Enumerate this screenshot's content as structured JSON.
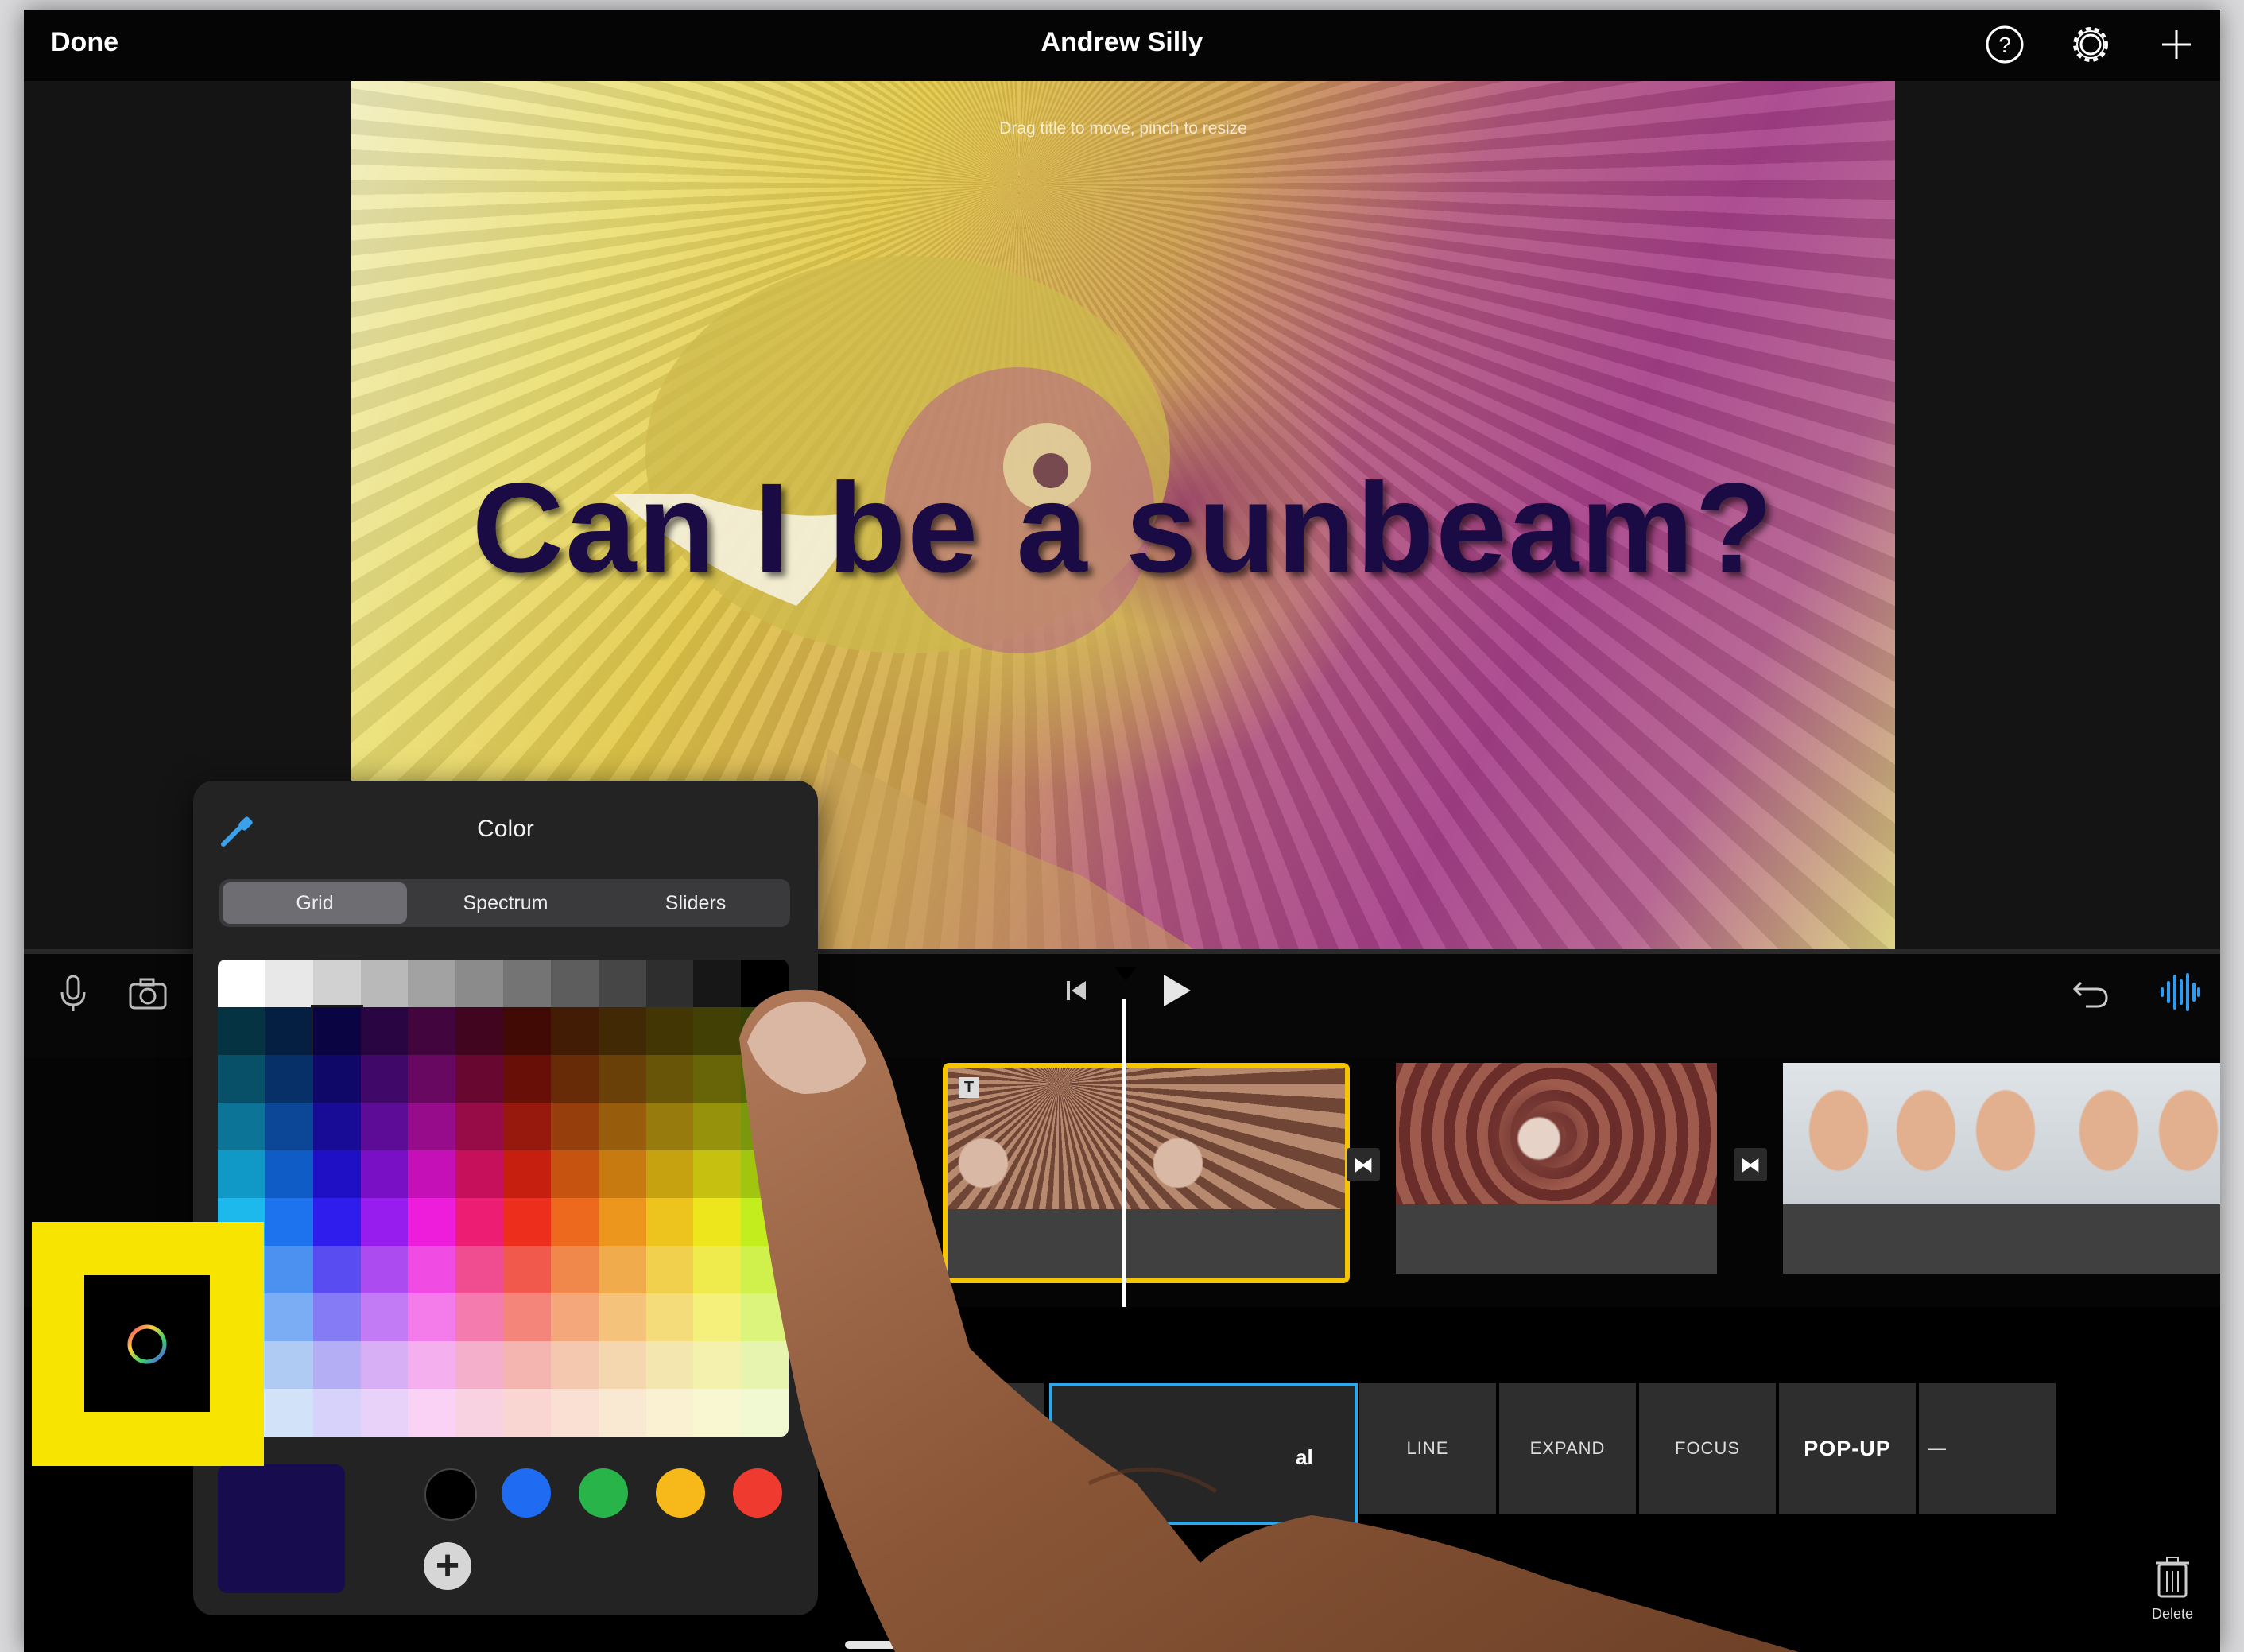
{
  "topbar": {
    "done_label": "Done",
    "project_title": "Andrew Silly",
    "icons": [
      "help-icon",
      "settings-gear-icon",
      "add-plus-icon"
    ]
  },
  "viewer": {
    "hint": "Drag title to move, pinch to resize",
    "caption": "Can I be a sunbeam?",
    "caption_color": "#1a0b44"
  },
  "timeline": {
    "left_icons": [
      "microphone-icon",
      "camera-icon"
    ],
    "transport_icons": [
      "skip-to-start-icon",
      "play-icon"
    ],
    "right_icons": [
      "undo-icon",
      "audio-waveform-icon"
    ],
    "clips": [
      "clip-1-sunbeam-selected",
      "clip-2-kaleidoscope",
      "clip-3-faces"
    ],
    "selected_clip_border": "#f6c500"
  },
  "color_popover": {
    "title": "Color",
    "tabs": [
      "Grid",
      "Spectrum",
      "Sliders"
    ],
    "selected_tab": "Grid",
    "current_color": "#170d4e",
    "favorites": [
      "#000000",
      "#1f6bf2",
      "#29b44a",
      "#f7b919",
      "#ef3a2f"
    ]
  },
  "title_styles": {
    "selected_fragment": "al",
    "tiles": [
      "LINE",
      "EXPAND",
      "FOCUS",
      "POP-UP",
      "—"
    ]
  },
  "bottom": {
    "delete_label": "Delete"
  },
  "colors": {
    "highlight": "#f7e400",
    "accent": "#30a7e8"
  }
}
